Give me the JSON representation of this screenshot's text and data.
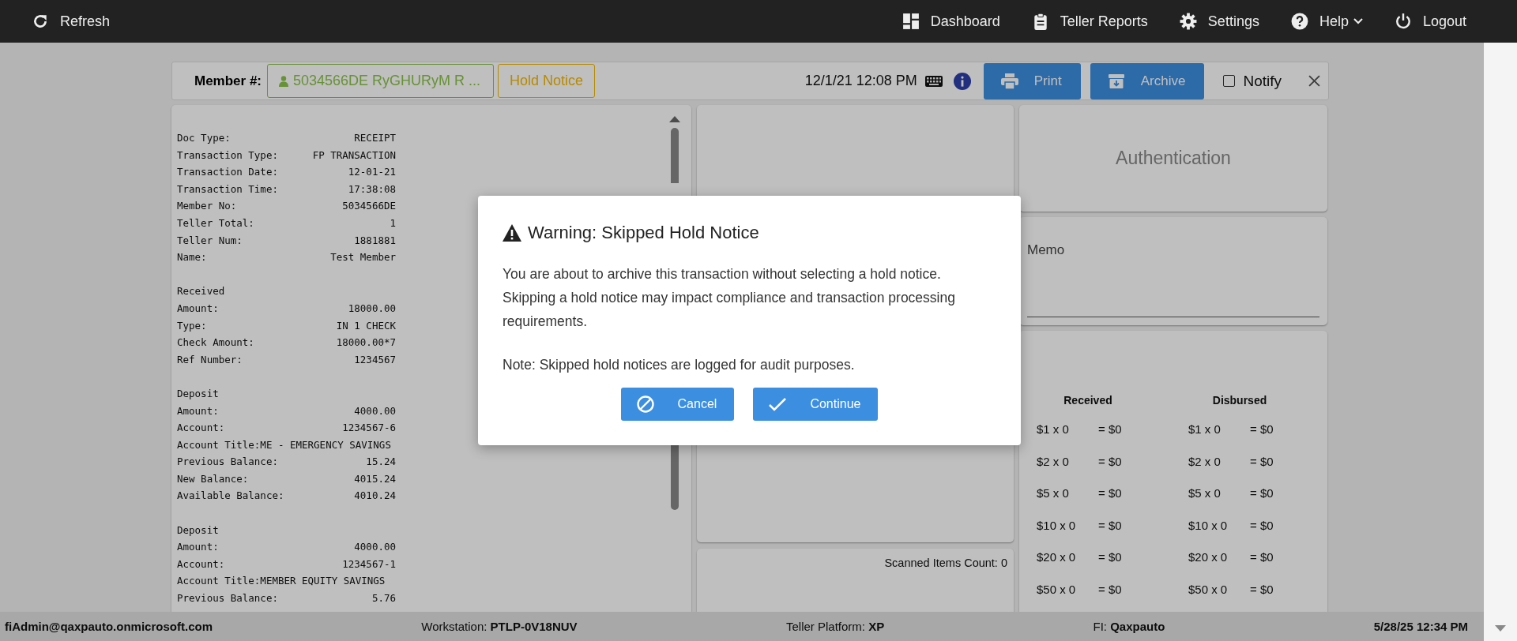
{
  "top_bar": {
    "left": [
      {
        "label": "Refresh",
        "kind": "refresh"
      }
    ],
    "right": [
      {
        "label": "Dashboard",
        "kind": "dashboard",
        "dropdown": false
      },
      {
        "label": "Teller Reports",
        "kind": "reports",
        "dropdown": false
      },
      {
        "label": "Settings",
        "kind": "settings",
        "dropdown": false
      },
      {
        "label": "Help",
        "kind": "help",
        "dropdown": true
      },
      {
        "label": "Logout",
        "kind": "logout",
        "dropdown": false
      }
    ]
  },
  "member_bar": {
    "label": "Member #:",
    "member": "5034566DE RyGHURyM R ...",
    "hold_notice": "Hold Notice",
    "datetime": "12/1/21 12:08 PM",
    "buttons": [
      {
        "label": "Print",
        "kind": "print"
      },
      {
        "label": "Archive",
        "kind": "archive"
      }
    ],
    "notify": {
      "label": "Notify",
      "checked": false
    }
  },
  "receipt": {
    "sections": [
      {
        "lines": [
          {
            "label": "Doc Type:",
            "value": "RECEIPT"
          },
          {
            "label": "Transaction Type:",
            "value": "FP TRANSACTION"
          },
          {
            "label": "Transaction Date:",
            "value": "12-01-21"
          },
          {
            "label": "Transaction Time:",
            "value": "17:38:08"
          },
          {
            "label": "Member No:",
            "value": "5034566DE"
          },
          {
            "label": "Teller Total:",
            "value": "1"
          },
          {
            "label": "Teller Num:",
            "value": "1881881"
          },
          {
            "label": "Name:",
            "value": "Test Member"
          }
        ]
      },
      {
        "heading": "Received",
        "lines": [
          {
            "label": "Amount:",
            "value": "18000.00"
          },
          {
            "label": "Type:",
            "value": "IN 1 CHECK"
          },
          {
            "label": "Check Amount:",
            "value": "18000.00*7"
          },
          {
            "label": "Ref Number:",
            "value": "1234567"
          }
        ]
      },
      {
        "heading": "Deposit",
        "lines": [
          {
            "label": "Amount:",
            "value": "4000.00"
          },
          {
            "label": "Account:",
            "value": "1234567-6"
          },
          {
            "text": "Account Title:ME - EMERGENCY SAVINGS"
          },
          {
            "label": "Previous Balance:",
            "value": "15.24"
          },
          {
            "label": "New Balance:",
            "value": "4015.24"
          },
          {
            "label": "Available Balance:",
            "value": "4010.24"
          }
        ]
      },
      {
        "heading": "Deposit",
        "lines": [
          {
            "label": "Amount:",
            "value": "4000.00"
          },
          {
            "label": "Account:",
            "value": "1234567-1"
          },
          {
            "text": "Account Title:MEMBER EQUITY SAVINGS"
          },
          {
            "label": "Previous Balance:",
            "value": "5.76"
          }
        ]
      }
    ]
  },
  "scanned_items": "Scanned Items Count: 0",
  "authentication": "Authentication",
  "memo": {
    "label": "Memo"
  },
  "cash": {
    "columns": [
      "Received",
      "Disbursed"
    ],
    "rows": [
      {
        "received_count": "$1 x 0",
        "received_total": "= $0",
        "disbursed_count": "$1 x 0",
        "disbursed_total": "= $0"
      },
      {
        "received_count": "$2 x 0",
        "received_total": "= $0",
        "disbursed_count": "$2 x 0",
        "disbursed_total": "= $0"
      },
      {
        "received_count": "$5 x 0",
        "received_total": "= $0",
        "disbursed_count": "$5 x 0",
        "disbursed_total": "= $0"
      },
      {
        "received_count": "$10 x 0",
        "received_total": "= $0",
        "disbursed_count": "$10 x 0",
        "disbursed_total": "= $0"
      },
      {
        "received_count": "$20 x 0",
        "received_total": "= $0",
        "disbursed_count": "$20 x 0",
        "disbursed_total": "= $0"
      },
      {
        "received_count": "$50 x 0",
        "received_total": "= $0",
        "disbursed_count": "$50 x 0",
        "disbursed_total": "= $0"
      }
    ]
  },
  "dialog": {
    "title": "Warning: Skipped Hold Notice",
    "message": "You are about to archive this transaction without selecting a hold notice. Skipping a hold notice may impact compliance and transaction processing requirements.",
    "note": "Note: Skipped hold notices are logged for audit purposes.",
    "buttons": [
      {
        "label": "Cancel",
        "kind": "cancel"
      },
      {
        "label": "Continue",
        "kind": "confirm"
      }
    ]
  },
  "status_bar": {
    "user": "fiAdmin@qaxpauto.onmicrosoft.com",
    "items": [
      "Workstation: **PTLP-0V18NUV**",
      "Teller Platform: **XP**",
      "FI: **Qaxpauto**"
    ],
    "datetime": "5/28/25 12:34 PM"
  }
}
